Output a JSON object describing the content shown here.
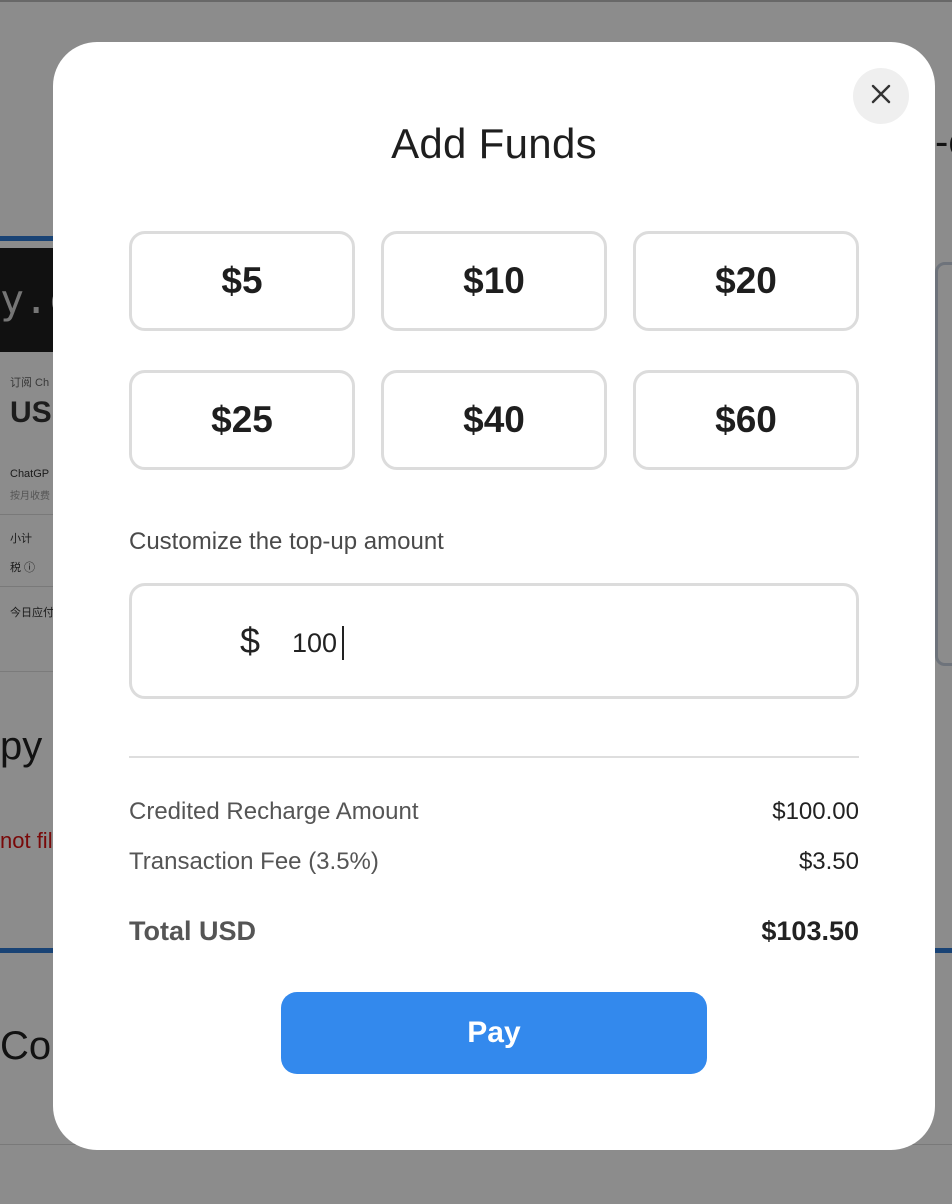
{
  "background": {
    "logo_text": "y.c",
    "subscribe_label": "订阅 Ch",
    "currency_code": "US",
    "item_name": "ChatGP",
    "item_sub": "按月收费",
    "subtotal_label": "小计",
    "tax_label": "税 ⓘ",
    "due_today_label": "今日应付",
    "copy_heading": "py",
    "error_text": "not fil",
    "copy_heading_2": "Cop",
    "right_title": "-c"
  },
  "modal": {
    "title": "Add Funds",
    "close_icon": "close-icon",
    "presets": [
      "$5",
      "$10",
      "$20",
      "$25",
      "$40",
      "$60"
    ],
    "custom_label": "Customize the top-up amount",
    "currency_symbol": "$",
    "amount_value": "100",
    "credited_label": "Credited Recharge Amount",
    "credited_value": "$100.00",
    "fee_label": "Transaction Fee (3.5%)",
    "fee_value": "$3.50",
    "total_label": "Total USD",
    "total_value": "$103.50",
    "pay_label": "Pay"
  },
  "colors": {
    "accent": "#3389ed",
    "overlay": "rgba(0,0,0,0.45)"
  }
}
